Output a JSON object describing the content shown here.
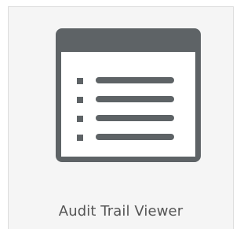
{
  "tile": {
    "label": "Audit Trail Viewer",
    "icon": "list-window-icon",
    "icon_color": "#5e6366",
    "icon_background": "#ffffff",
    "tile_background": "#f5f5f5",
    "border_color": "#dcdcdc",
    "label_color": "#555555"
  }
}
